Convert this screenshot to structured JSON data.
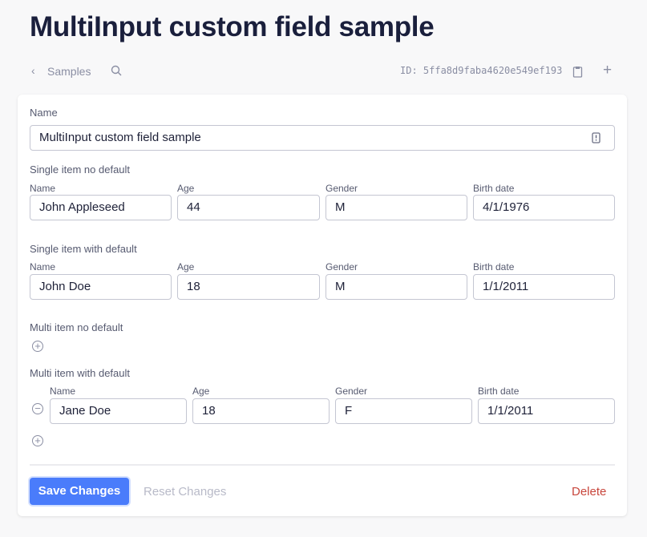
{
  "title": "MultiInput custom field sample",
  "nav": {
    "back_label": "Samples",
    "id_text": "ID: 5ffa8d9faba4620e549ef193"
  },
  "form": {
    "name_label": "Name",
    "name_value": "MultiInput custom field sample",
    "s1": {
      "label": "Single item no default",
      "cols": [
        "Name",
        "Age",
        "Gender",
        "Birth date"
      ],
      "values": [
        "John Appleseed",
        "44",
        "M",
        "4/1/1976"
      ]
    },
    "s2": {
      "label": "Single item with default",
      "cols": [
        "Name",
        "Age",
        "Gender",
        "Birth date"
      ],
      "values": [
        "John Doe",
        "18",
        "M",
        "1/1/2011"
      ]
    },
    "m1": {
      "label": "Multi item no default"
    },
    "m2": {
      "label": "Multi item with default",
      "cols": [
        "Name",
        "Age",
        "Gender",
        "Birth date"
      ],
      "rows": [
        [
          "Jane Doe",
          "18",
          "F",
          "1/1/2011"
        ]
      ]
    }
  },
  "actions": {
    "save": "Save Changes",
    "reset": "Reset Changes",
    "delete": "Delete"
  },
  "colors": {
    "primary": "#4a7cfb",
    "danger": "#c8463c"
  }
}
